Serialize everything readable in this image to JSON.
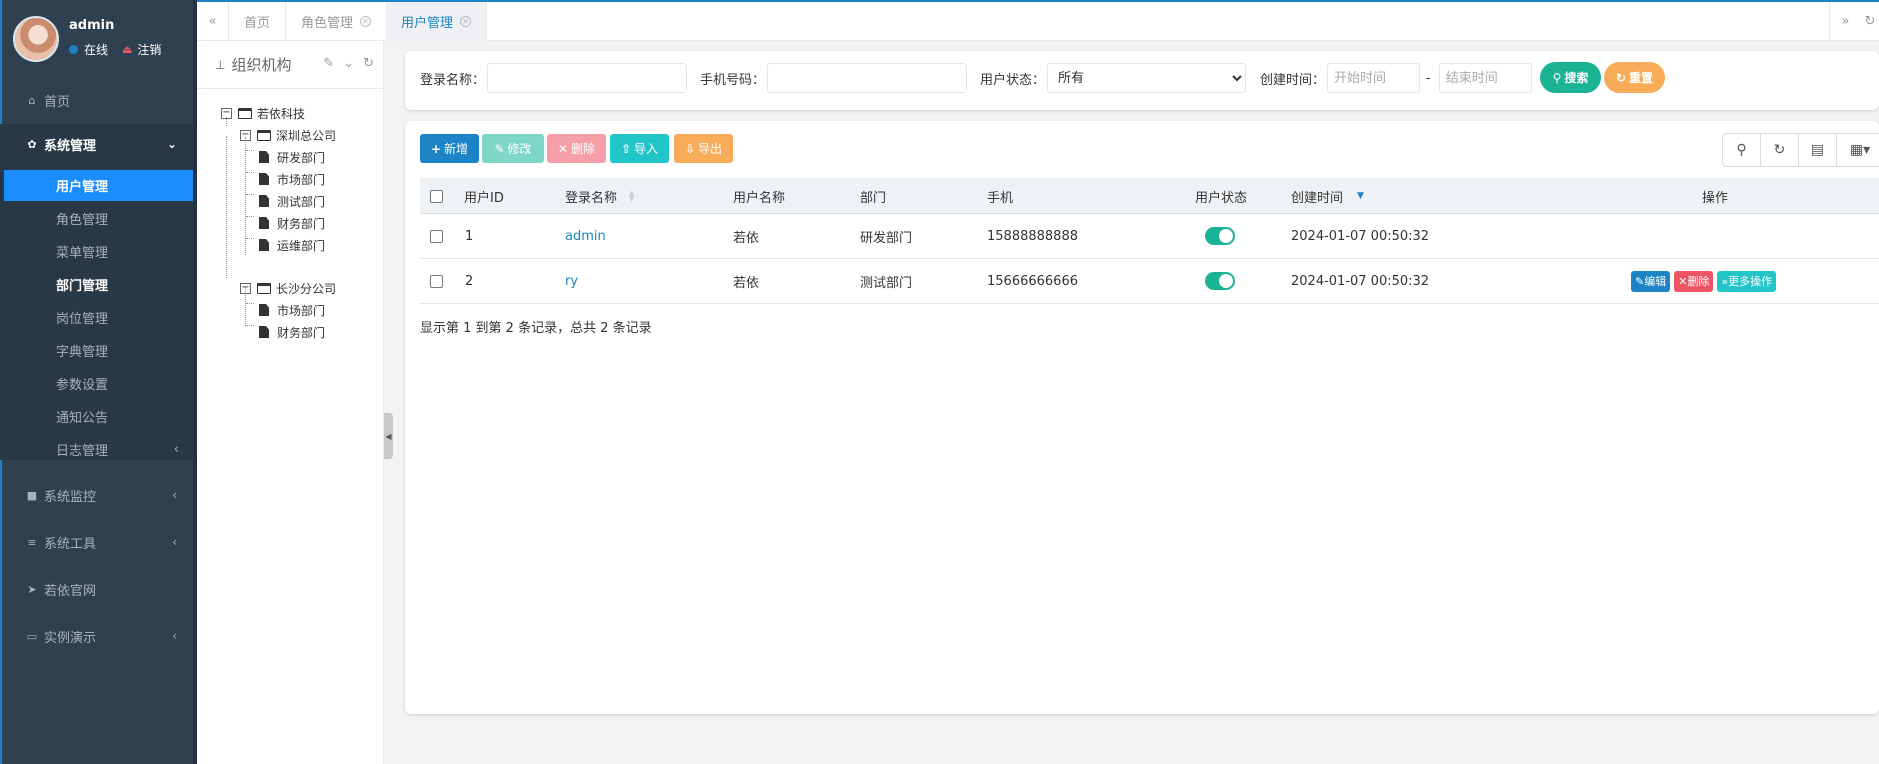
{
  "profile": {
    "name": "admin",
    "status": "在线",
    "logout": "注销"
  },
  "nav": {
    "home": "首页",
    "system": "系统管理",
    "sub": [
      "用户管理",
      "角色管理",
      "菜单管理",
      "部门管理",
      "岗位管理",
      "字典管理",
      "参数设置",
      "通知公告",
      "日志管理"
    ],
    "monitor": "系统监控",
    "tools": "系统工具",
    "website": "若依官网",
    "demo": "实例演示"
  },
  "tabs": [
    {
      "label": "首页",
      "closable": false
    },
    {
      "label": "角色管理",
      "closable": true
    },
    {
      "label": "用户管理",
      "closable": true,
      "active": true
    }
  ],
  "tree": {
    "title": "组织机构",
    "root": "若依科技",
    "sz": "深圳总公司",
    "sz_children": [
      "研发部门",
      "市场部门",
      "测试部门",
      "财务部门",
      "运维部门"
    ],
    "cs": "长沙分公司",
    "cs_children": [
      "市场部门",
      "财务部门"
    ]
  },
  "search": {
    "login_label": "登录名称：",
    "phone_label": "手机号码：",
    "status_label": "用户状态：",
    "status_value": "所有",
    "time_label": "创建时间：",
    "start_placeholder": "开始时间",
    "sep": "-",
    "end_placeholder": "结束时间",
    "search_btn": "搜索",
    "reset_btn": "重置"
  },
  "toolbar": {
    "add": "新增",
    "edit": "修改",
    "delete": "删除",
    "import": "导入",
    "export": "导出"
  },
  "table": {
    "headers": [
      "用户ID",
      "登录名称",
      "用户名称",
      "部门",
      "手机",
      "用户状态",
      "创建时间",
      "操作"
    ],
    "rows": [
      {
        "id": "1",
        "login": "admin",
        "name": "若依",
        "dept": "研发部门",
        "phone": "15888888888",
        "enabled": true,
        "created": "2024-01-07 00:50:32"
      },
      {
        "id": "2",
        "login": "ry",
        "name": "若依",
        "dept": "测试部门",
        "phone": "15666666666",
        "enabled": true,
        "created": "2024-01-07 00:50:32"
      }
    ],
    "op_edit": "编辑",
    "op_delete": "删除",
    "op_more": "更多操作",
    "pager": "显示第 1 到第 2 条记录，总共 2 条记录"
  },
  "colors": {
    "primary": "#1c84c6",
    "success": "#1ab394",
    "danger": "#ed5565",
    "info": "#23c6c8",
    "warning": "#f8ac59",
    "sidebar": "#2f4050",
    "active_menu": "#1c8dfd"
  },
  "icons": [
    "home-icon",
    "gear-icon",
    "video-icon",
    "bars-icon",
    "send-icon",
    "desktop-icon",
    "sitemap-icon",
    "search-icon",
    "refresh-icon",
    "columns-icon",
    "grid-icon"
  ]
}
